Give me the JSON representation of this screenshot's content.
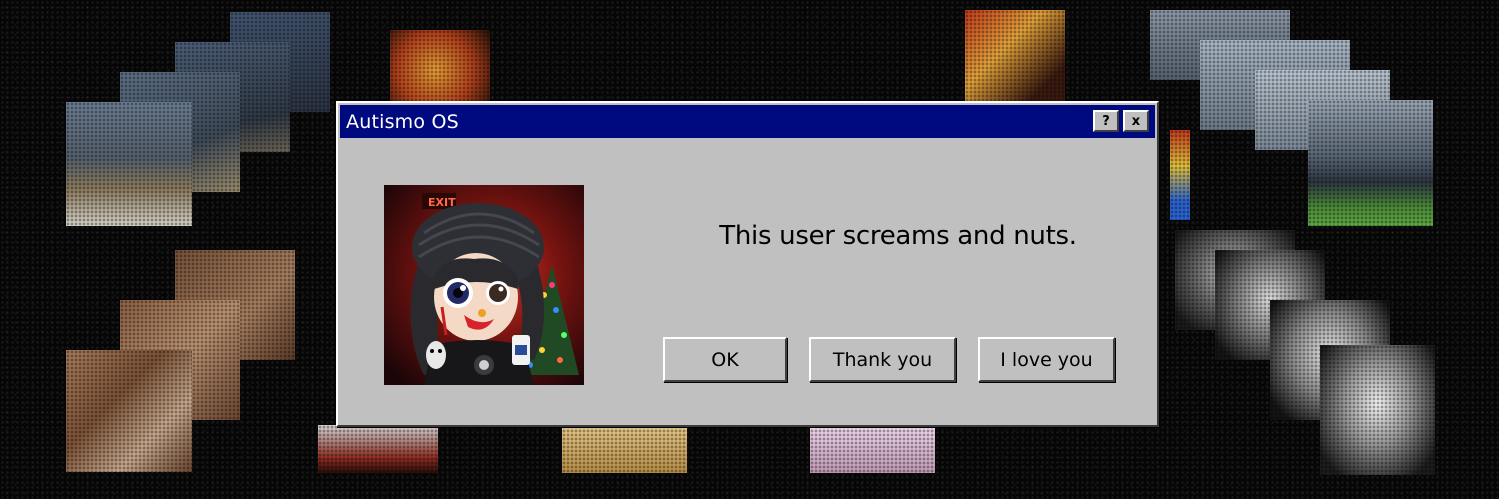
{
  "window": {
    "title": "Autismo OS",
    "help_label": "?",
    "close_label": "x"
  },
  "avatar": {
    "sign_text": "EXIT"
  },
  "dialog": {
    "message": "This user screams and nuts."
  },
  "buttons": {
    "ok": "OK",
    "thank_you": "Thank you",
    "love_you": "I love you"
  },
  "colors": {
    "titlebar": "#000a80",
    "dialog_face": "#c0c0c0"
  }
}
